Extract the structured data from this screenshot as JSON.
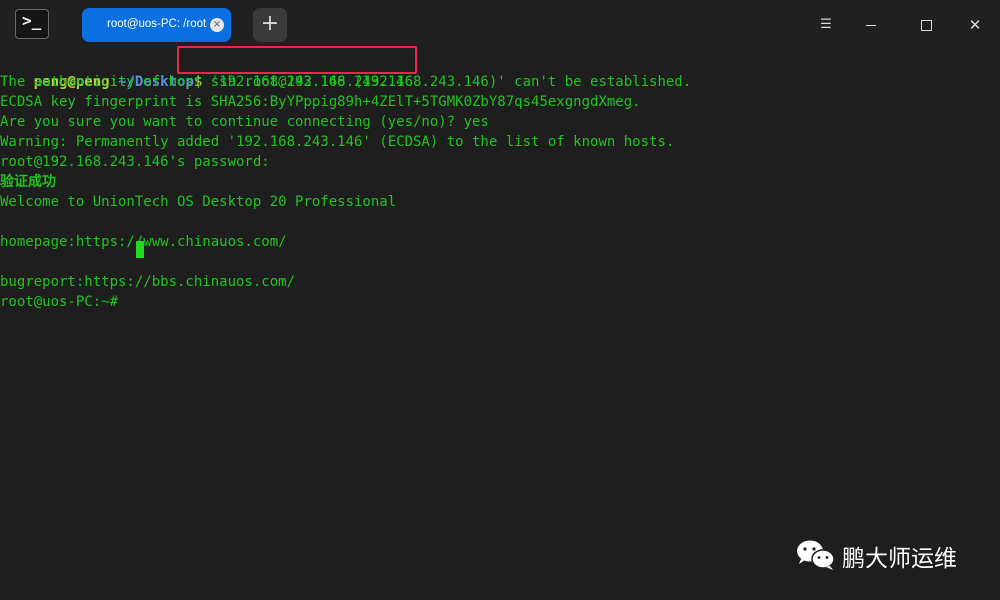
{
  "window": {
    "tab_title": "root@uos-PC: /root",
    "tab_close": "×",
    "add_tab": "+",
    "menu_glyph": "☰",
    "close_glyph": "✕",
    "app_icon_glyph": ">_",
    "icons": [
      "terminal-app-icon",
      "plus-icon",
      "menu-icon",
      "minimize-icon",
      "maximize-icon",
      "close-icon"
    ]
  },
  "terminal": {
    "prompt_user": "peng@peng",
    "prompt_colon": ":",
    "prompt_path": "~/Desktop",
    "prompt_dollar": "$",
    "command": " ssh root@192.168.243.146",
    "lines": [
      "The authenticity of host '192.168.243.146 (192.168.243.146)' can't be established.",
      "ECDSA key fingerprint is SHA256:ByYPppig89h+4ZElT+5TGMK0ZbY87qs45exgngdXmeg.",
      "Are you sure you want to continue connecting (yes/no)? yes",
      "Warning: Permanently added '192.168.243.146' (ECDSA) to the list of known hosts.",
      "root@192.168.243.146's password:",
      "验证成功",
      "Welcome to UnionTech OS Desktop 20 Professional",
      "",
      "homepage:https://www.chinauos.com/",
      "",
      "bugreport:https://bbs.chinauos.com/",
      "root@uos-PC:~# "
    ],
    "colors": {
      "green": "#21c321",
      "user": "#bcd13f",
      "path": "#5c8fe0",
      "highlight": "#e8284a",
      "tab": "#0a6fe0"
    }
  },
  "watermark": {
    "text": "鹏大师运维",
    "icon": "wechat-icon"
  }
}
